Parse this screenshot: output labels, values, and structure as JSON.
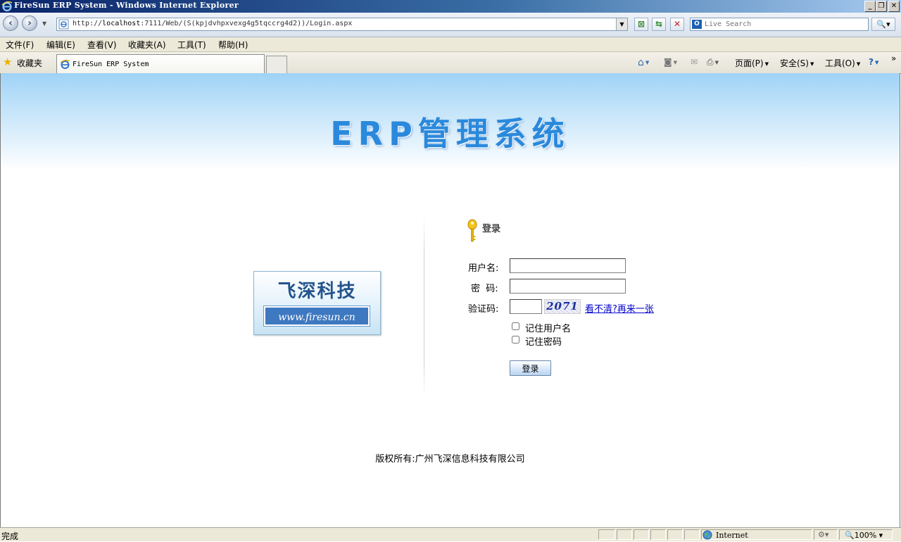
{
  "window": {
    "title": "FireSun ERP System - Windows Internet Explorer",
    "controls": {
      "minimize": "_",
      "restore": "❐",
      "close": "✕"
    }
  },
  "addressbar": {
    "url_prefix": "http://",
    "url_host": "localhost",
    "url_rest": ":7111/Web/(S(kpjdvhpxvexg4g5tqccrg4d2))/Login.aspx",
    "search_placeholder": "Live Search"
  },
  "menu": {
    "items": [
      "文件(F)",
      "编辑(E)",
      "查看(V)",
      "收藏夹(A)",
      "工具(T)",
      "帮助(H)"
    ]
  },
  "tabs": {
    "favorites_label": "收藏夹",
    "active_tab_title": "FireSun ERP System"
  },
  "commandbar": {
    "page": "页面(P)",
    "safety": "安全(S)",
    "tools": "工具(O)"
  },
  "page": {
    "banner_title": "ERP管理系统",
    "logo": {
      "company": "飞深科技",
      "url": "www.firesun.cn"
    },
    "login": {
      "heading": "登录",
      "username_label": "用户名:",
      "password_label": "密  码:",
      "captcha_label": "验证码:",
      "captcha_code": "2071",
      "refresh_link": "看不清?再来一张",
      "remember_username": "记住用户名",
      "remember_password": "记住密码",
      "submit": "登录"
    },
    "copyright": "版权所有:广州飞深信息科技有限公司"
  },
  "statusbar": {
    "text": "完成",
    "zone": "Internet",
    "zoom": "100%"
  },
  "colors": {
    "banner_title": "#2a89dc",
    "link": "#0000cc",
    "titlebar_start": "#0a246a"
  }
}
